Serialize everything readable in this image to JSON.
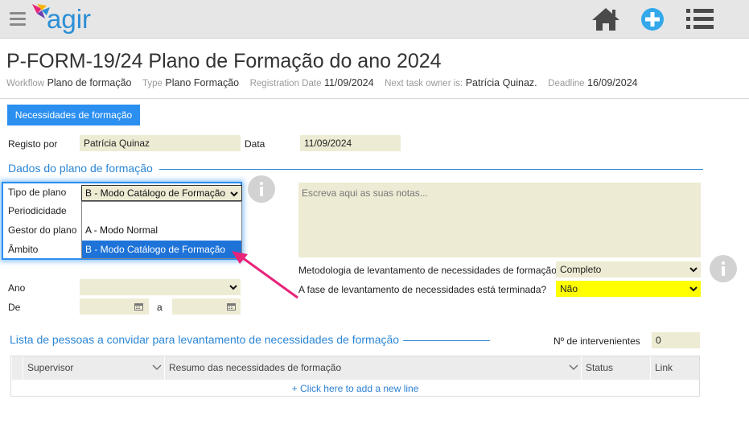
{
  "app": {
    "logo_text": "agir",
    "icons": [
      "hamburger-menu-icon",
      "home-icon",
      "plus-circle-icon",
      "list-icon"
    ],
    "colors": {
      "accent": "#2b8ff0",
      "field_bg": "#edebd3",
      "highlight_field": "#ffff00",
      "arrow": "#e8237a"
    }
  },
  "header": {
    "title": "P-FORM-19/24 Plano de Formação do ano 2024",
    "meta": [
      {
        "label": "Workflow",
        "value": "Plano de formação"
      },
      {
        "label": "Type",
        "value": "Plano Formação"
      },
      {
        "label": "Registration Date",
        "value": "11/09/2024"
      },
      {
        "label": "Next task owner is:",
        "value": "Patrícia Quinaz."
      },
      {
        "label": "Deadline",
        "value": "16/09/2024"
      }
    ]
  },
  "tabs": {
    "active": "Necessidades de formação"
  },
  "registo": {
    "registo_por_label": "Registo por",
    "registo_por_value": "Patrícia Quinaz",
    "data_label": "Data",
    "data_value": "11/09/2024"
  },
  "dados_plano": {
    "section_title": "Dados do plano de formação",
    "tipo_plano_label": "Tipo de plano",
    "tipo_plano_value": "B - Modo Catálogo de Formação",
    "tipo_plano_options": [
      "",
      "A - Modo Normal",
      "B - Modo Catálogo de Formação"
    ],
    "periodicidade_label": "Periodicidade",
    "gestor_label": "Gestor do plano",
    "ambito_label": "Âmbito",
    "ano_label": "Ano",
    "ano_value": "",
    "de_label": "De",
    "a_label": "a",
    "notes_placeholder": "Escreva aqui as suas notas...",
    "metodologia_label": "Metodologia de levantamento de necessidades de formação",
    "metodologia_value": "Completo",
    "fase_label": "A fase de levantamento de necessidades está terminada?",
    "fase_value": "Não"
  },
  "lista": {
    "section_title": "Lista de pessoas a convidar para levantamento de necessidades de formação",
    "intervenientes_label": "Nº de intervenientes",
    "intervenientes_value": "0",
    "columns": [
      "Supervisor",
      "Resumo das necessidades de formação",
      "Status",
      "Link"
    ],
    "add_line": "+ Click here to add a new line"
  }
}
